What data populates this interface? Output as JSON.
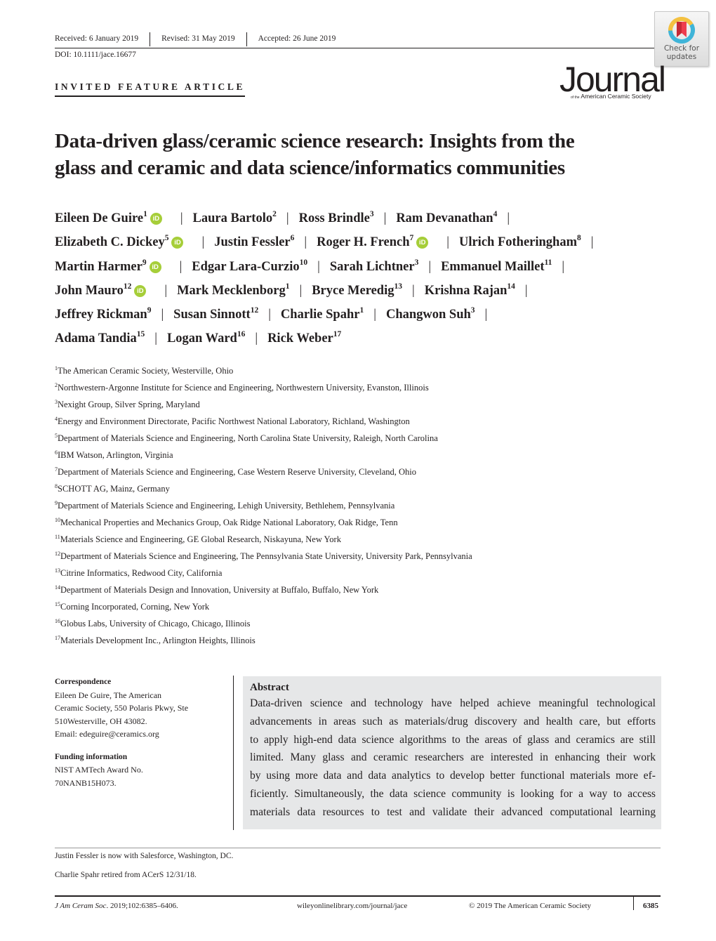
{
  "header": {
    "received": "Received: 6 January 2019",
    "revised": "Revised: 31 May 2019",
    "accepted": "Accepted: 26 June 2019",
    "doi": "DOI: 10.1111/jace.16677",
    "article_type": "INVITED FEATURE ARTICLE",
    "check_updates": {
      "line1": "Check for",
      "line2": "updates",
      "icon": "bookmark-ring-icon"
    },
    "journal_logo": {
      "word": "Journal",
      "sub_prefix": "of the",
      "subtitle": "American Ceramic Society"
    }
  },
  "title": {
    "line1": "Data-driven glass/ceramic science research: Insights from the",
    "line2": "glass and ceramic and data science/informatics communities"
  },
  "authors": [
    [
      {
        "name": "Eileen De Guire",
        "aff": "1",
        "orcid": true
      },
      {
        "name": "Laura Bartolo",
        "aff": "2"
      },
      {
        "name": "Ross Brindle",
        "aff": "3"
      },
      {
        "name": "Ram Devanathan",
        "aff": "4"
      }
    ],
    [
      {
        "name": "Elizabeth C. Dickey",
        "aff": "5",
        "orcid": true
      },
      {
        "name": "Justin Fessler",
        "aff": "6"
      },
      {
        "name": "Roger H. French",
        "aff": "7",
        "orcid": true
      },
      {
        "name": "Ulrich Fotheringham",
        "aff": "8"
      }
    ],
    [
      {
        "name": "Martin Harmer",
        "aff": "9",
        "orcid": true
      },
      {
        "name": "Edgar Lara-Curzio",
        "aff": "10"
      },
      {
        "name": "Sarah Lichtner",
        "aff": "3"
      },
      {
        "name": "Emmanuel Maillet",
        "aff": "11"
      }
    ],
    [
      {
        "name": "John Mauro",
        "aff": "12",
        "orcid": true
      },
      {
        "name": "Mark Mecklenborg",
        "aff": "1"
      },
      {
        "name": "Bryce Meredig",
        "aff": "13"
      },
      {
        "name": "Krishna Rajan",
        "aff": "14"
      }
    ],
    [
      {
        "name": "Jeffrey Rickman",
        "aff": "9"
      },
      {
        "name": "Susan Sinnott",
        "aff": "12"
      },
      {
        "name": "Charlie Spahr",
        "aff": "1"
      },
      {
        "name": "Changwon Suh",
        "aff": "3"
      }
    ],
    [
      {
        "name": "Adama Tandia",
        "aff": "15"
      },
      {
        "name": "Logan Ward",
        "aff": "16"
      },
      {
        "name": "Rick Weber",
        "aff": "17"
      }
    ]
  ],
  "separator": "|",
  "orcid_label": "iD",
  "affiliations": [
    {
      "n": "1",
      "text": "The American Ceramic Society, Westerville, Ohio"
    },
    {
      "n": "2",
      "text": "Northwestern-Argonne Institute for Science and Engineering, Northwestern University, Evanston, Illinois"
    },
    {
      "n": "3",
      "text": "Nexight Group, Silver Spring, Maryland"
    },
    {
      "n": "4",
      "text": "Energy and Environment Directorate, Pacific Northwest National Laboratory, Richland, Washington"
    },
    {
      "n": "5",
      "text": "Department of Materials Science and Engineering, North Carolina State University, Raleigh, North Carolina"
    },
    {
      "n": "6",
      "text": "IBM Watson, Arlington, Virginia"
    },
    {
      "n": "7",
      "text": "Department of Materials Science and Engineering, Case Western Reserve University, Cleveland, Ohio"
    },
    {
      "n": "8",
      "text": "SCHOTT AG, Mainz, Germany"
    },
    {
      "n": "9",
      "text": "Department of Materials Science and Engineering, Lehigh University, Bethlehem, Pennsylvania"
    },
    {
      "n": "10",
      "text": "Mechanical Properties and Mechanics Group, Oak Ridge National Laboratory, Oak Ridge, Tenn"
    },
    {
      "n": "11",
      "text": "Materials Science and Engineering, GE Global Research, Niskayuna, New York"
    },
    {
      "n": "12",
      "text": "Department of Materials Science and Engineering, The Pennsylvania State University, University Park, Pennsylvania"
    },
    {
      "n": "13",
      "text": "Citrine Informatics, Redwood City, California"
    },
    {
      "n": "14",
      "text": "Department of Materials Design and Innovation, University at Buffalo, Buffalo, New York"
    },
    {
      "n": "15",
      "text": "Corning Incorporated, Corning, New York"
    },
    {
      "n": "16",
      "text": "Globus Labs, University of Chicago, Chicago, Illinois"
    },
    {
      "n": "17",
      "text": "Materials Development Inc., Arlington Heights, Illinois"
    }
  ],
  "correspondence": {
    "heading": "Correspondence",
    "lines": [
      "Eileen De Guire, The American",
      "Ceramic Society, 550 Polaris Pkwy, Ste",
      "510Westerville, OH 43082.",
      "Email: edeguire@ceramics.org"
    ]
  },
  "funding": {
    "heading": "Funding information",
    "lines": [
      "NIST AMTech Award No.",
      "70NANB15H073."
    ]
  },
  "abstract": {
    "heading": "Abstract",
    "lines": [
      "Data-driven science and technology have helped achieve meaningful technological",
      "advancements in areas such as materials/drug discovery and health care, but efforts",
      "to apply high-end data science algorithms to the areas of glass and ceramics are still",
      "limited. Many glass and ceramic researchers are interested in enhancing their work",
      "by using more data and data analytics to develop better functional materials more ef-",
      "ficiently. Simultaneously, the data science community is looking for a way to access",
      "materials data resources to test and validate their advanced computational learning"
    ]
  },
  "footnotes": [
    "Justin Fessler is now with Salesforce, Washington, DC.",
    "Charlie Spahr retired from ACerS 12/31/18."
  ],
  "footer": {
    "citation_journal": "J Am Ceram Soc",
    "citation_rest": ". 2019;102:6385–6406.",
    "url": "wileyonlinelibrary.com/journal/jace",
    "copyright": "© 2019 The American Ceramic Society",
    "page": "6385"
  },
  "colors": {
    "orcid_green": "#a6ce39",
    "abstract_bg": "#e6e7e8",
    "text": "#231f20"
  }
}
